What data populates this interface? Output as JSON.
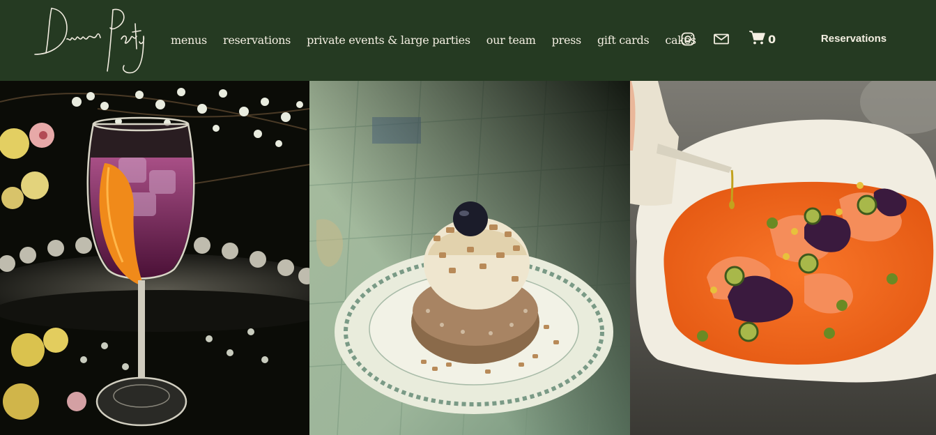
{
  "header": {
    "logo_text": "Dinner Party",
    "nav": [
      {
        "label": "menus"
      },
      {
        "label": "reservations"
      },
      {
        "label": "private events & large parties"
      },
      {
        "label": "our team"
      },
      {
        "label": "press"
      },
      {
        "label": "gift cards"
      },
      {
        "label": "cakes"
      }
    ],
    "icons": {
      "instagram": "instagram-icon",
      "mail": "mail-icon",
      "cart": "cart-icon"
    },
    "cart_count": "0",
    "reservations_button": "Reservations"
  },
  "gallery": {
    "images": [
      {
        "subject": "cocktail-glass-with-orange-peel-and-flowers"
      },
      {
        "subject": "pastry-with-ice-cream-on-floral-plate"
      },
      {
        "subject": "crudo-in-orange-broth-with-oil-drizzle"
      }
    ]
  },
  "colors": {
    "header_bg": "#253a22",
    "nav_text": "#f4efe2",
    "tile_green": "#9cb49a",
    "broth_orange": "#f26a1c"
  }
}
